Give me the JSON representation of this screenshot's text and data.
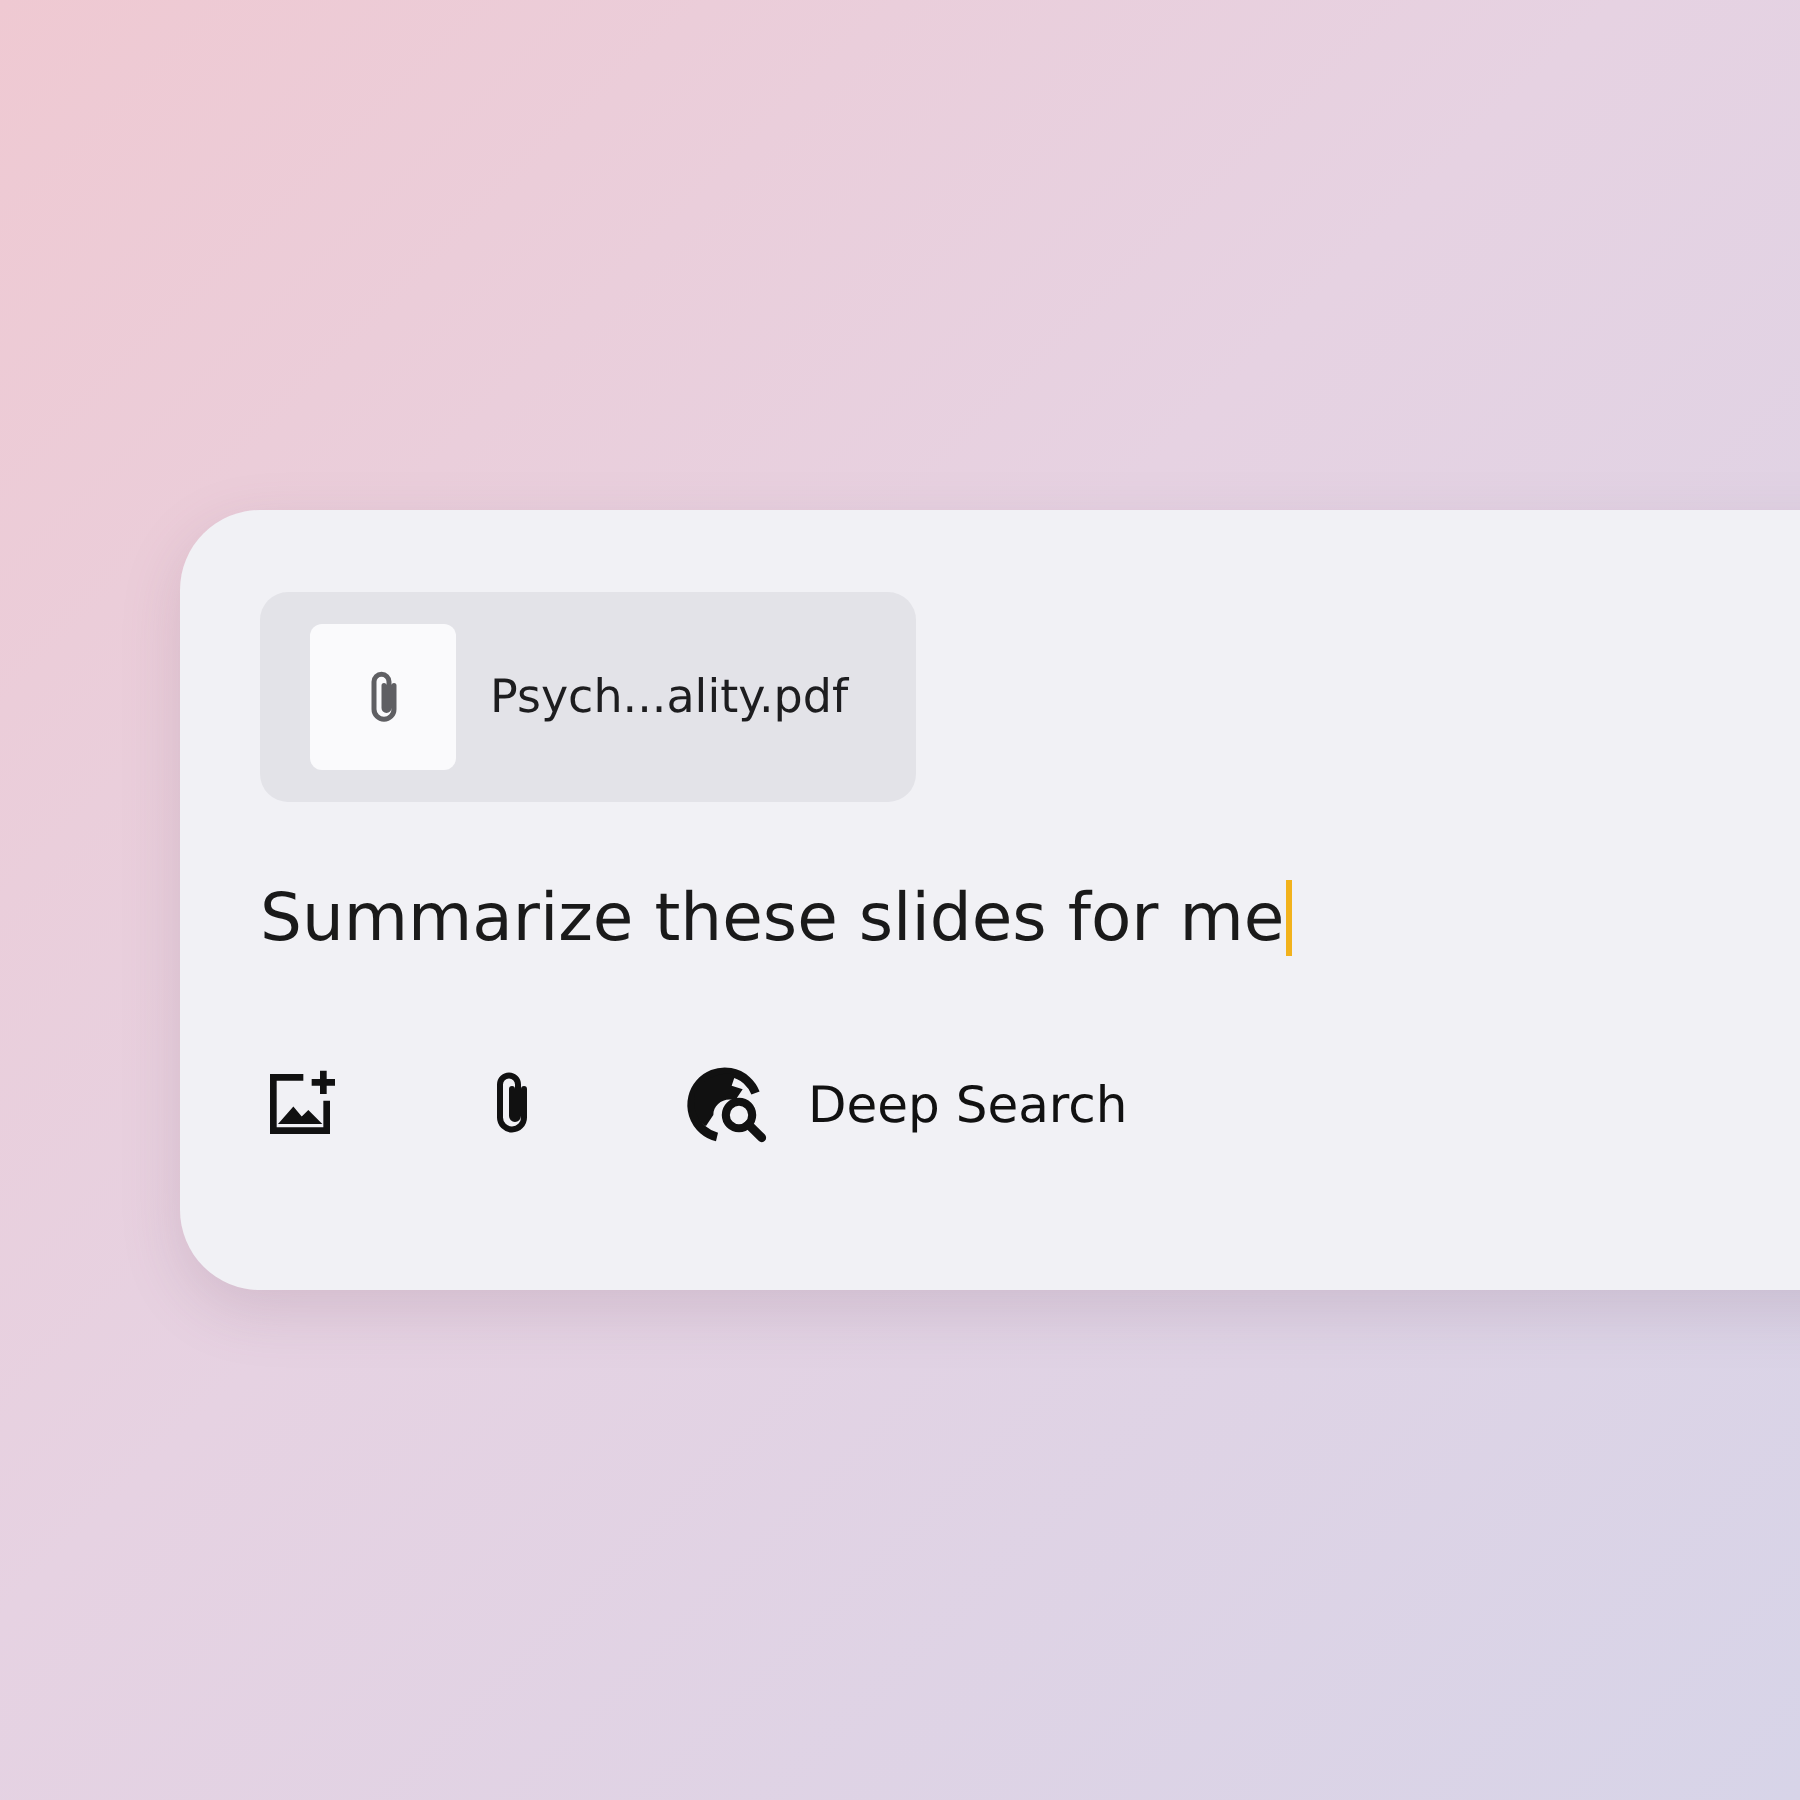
{
  "attachment": {
    "filename": "Psych...ality.pdf"
  },
  "prompt": {
    "value": "Summarize these slides for me",
    "focused": true
  },
  "toolbar": [
    {
      "kind": "image"
    },
    {
      "kind": "attach"
    },
    {
      "kind": "deep_search",
      "label": "Deep Search"
    }
  ]
}
